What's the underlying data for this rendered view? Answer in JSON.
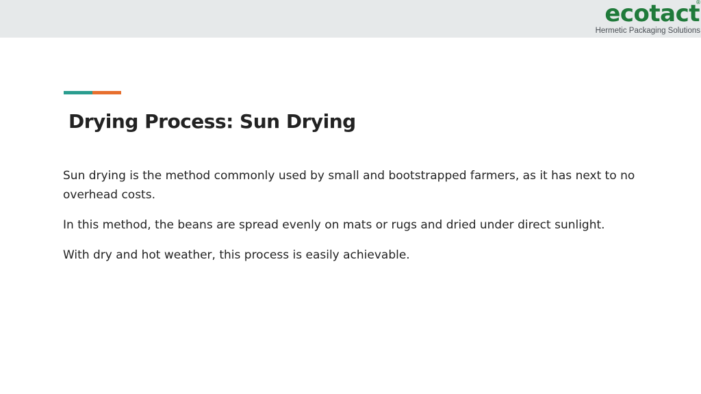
{
  "header": {
    "logo": {
      "wordmark": "ecotact",
      "registered_mark": "®",
      "tagline": "Hermetic Packaging Solutions"
    },
    "band_color": "#e6e9ea"
  },
  "accent": {
    "left_color": "#2a9d8f",
    "right_color": "#e76f2e"
  },
  "slide": {
    "title": "Drying Process: Sun Drying",
    "paragraphs": [
      "Sun drying is the method commonly used by small and bootstrapped farmers, as it has next to no overhead costs.",
      "In this method, the beans are spread evenly on mats or rugs and dried under direct sunlight.",
      "With dry and hot weather, this process is easily achievable."
    ]
  }
}
